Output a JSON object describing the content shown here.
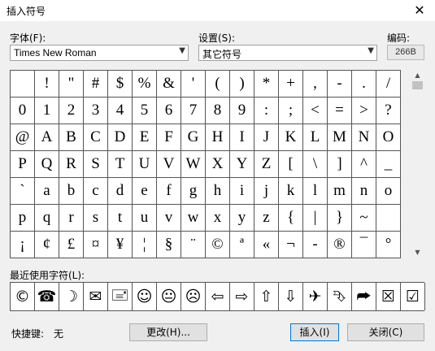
{
  "window": {
    "title": "插入符号",
    "close_glyph": "✕"
  },
  "font": {
    "label": "字体(F):",
    "value": "Times New Roman"
  },
  "subset": {
    "label": "设置(S):",
    "value": "其它符号"
  },
  "code": {
    "label": "编码:",
    "value": "266B"
  },
  "symbols": [
    [
      "",
      "!",
      "\"",
      "#",
      "$",
      "%",
      "&",
      "'",
      "(",
      ")",
      "*",
      "+",
      ",",
      "-",
      ".",
      "/"
    ],
    [
      "0",
      "1",
      "2",
      "3",
      "4",
      "5",
      "6",
      "7",
      "8",
      "9",
      ":",
      ";",
      "<",
      "=",
      ">",
      "?"
    ],
    [
      "@",
      "A",
      "B",
      "C",
      "D",
      "E",
      "F",
      "G",
      "H",
      "I",
      "J",
      "K",
      "L",
      "M",
      "N",
      "O"
    ],
    [
      "P",
      "Q",
      "R",
      "S",
      "T",
      "U",
      "V",
      "W",
      "X",
      "Y",
      "Z",
      "[",
      "\\",
      "]",
      "^",
      "_"
    ],
    [
      "`",
      "a",
      "b",
      "c",
      "d",
      "e",
      "f",
      "g",
      "h",
      "i",
      "j",
      "k",
      "l",
      "m",
      "n",
      "o"
    ],
    [
      "p",
      "q",
      "r",
      "s",
      "t",
      "u",
      "v",
      "w",
      "x",
      "y",
      "z",
      "{",
      "|",
      "}",
      "~",
      ""
    ],
    [
      "¡",
      "¢",
      "£",
      "¤",
      "¥",
      "¦",
      "§",
      "¨",
      "©",
      "ª",
      "«",
      "¬",
      "-",
      "®",
      "¯",
      "°"
    ]
  ],
  "recent": {
    "label": "最近使用字符(L):",
    "symbols": [
      "©",
      "☎",
      "☽",
      "✉",
      "🖃",
      "☺",
      "😐",
      "☹",
      "⇦",
      "⇨",
      "⇧",
      "⇩",
      "✈",
      "⮷",
      "⮫",
      "☒",
      "☑"
    ]
  },
  "shortcut": {
    "label": "快捷键:",
    "value": "无"
  },
  "buttons": {
    "change": "更改(H)...",
    "insert": "插入(I)",
    "close": "关闭(C)"
  },
  "scroll": {
    "up_glyph": "▲",
    "down_glyph": "▼"
  }
}
